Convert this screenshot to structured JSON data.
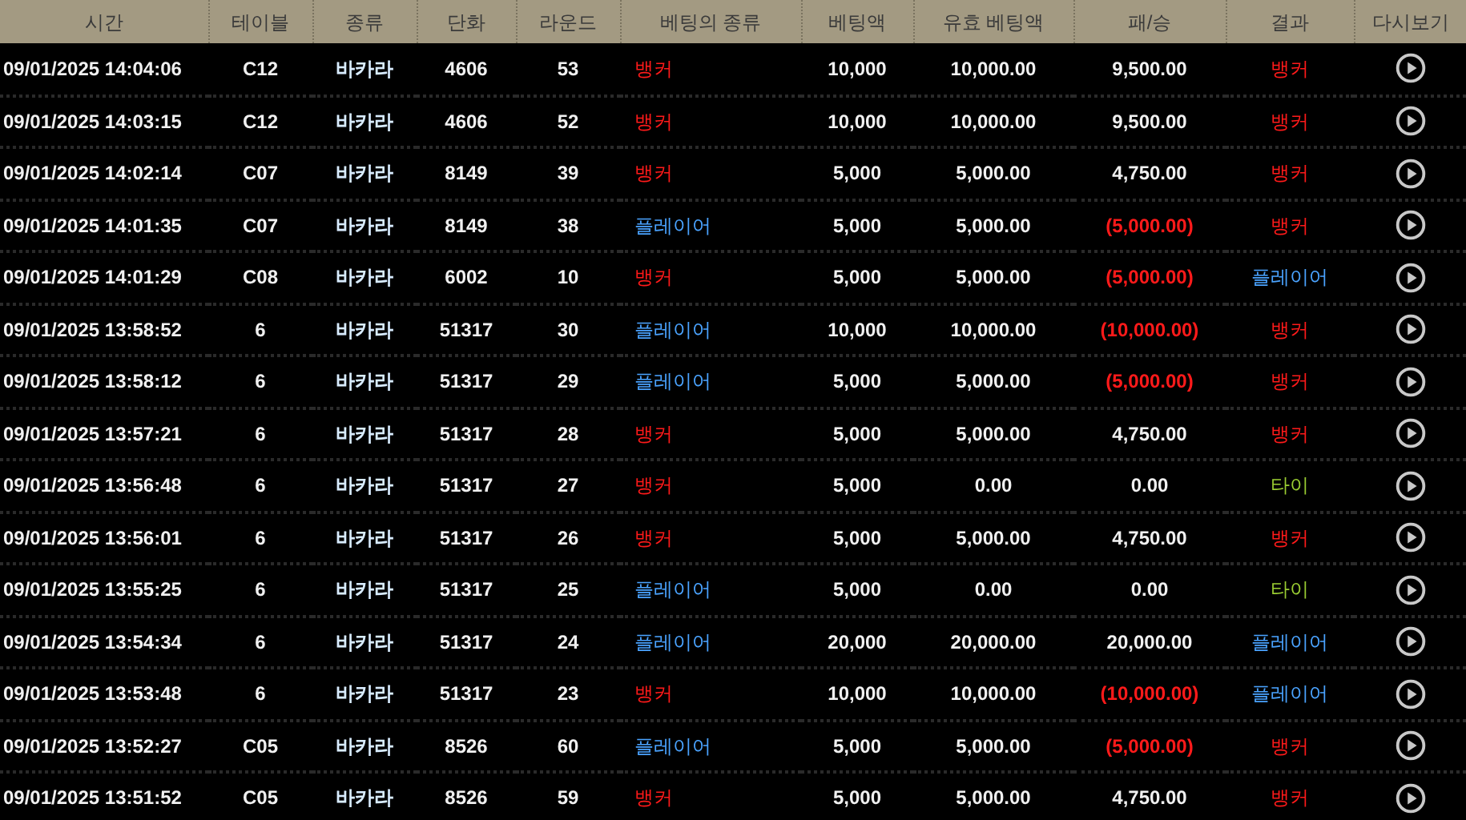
{
  "columns": [
    "시간",
    "테이블",
    "종류",
    "단화",
    "라운드",
    "베팅의 종류",
    "베팅액",
    "유효 베팅액",
    "패/승",
    "결과",
    "다시보기"
  ],
  "rows": [
    {
      "time": "09/01/2025 14:04:06",
      "table": "C12",
      "game": "바카라",
      "shoe": "4606",
      "round": "53",
      "bet": {
        "text": "뱅커",
        "kind": "banker"
      },
      "amount": "10,000",
      "valid": "10,000.00",
      "winloss": {
        "text": "9,500.00",
        "negative": false
      },
      "result": {
        "text": "뱅커",
        "kind": "banker"
      }
    },
    {
      "time": "09/01/2025 14:03:15",
      "table": "C12",
      "game": "바카라",
      "shoe": "4606",
      "round": "52",
      "bet": {
        "text": "뱅커",
        "kind": "banker"
      },
      "amount": "10,000",
      "valid": "10,000.00",
      "winloss": {
        "text": "9,500.00",
        "negative": false
      },
      "result": {
        "text": "뱅커",
        "kind": "banker"
      }
    },
    {
      "time": "09/01/2025 14:02:14",
      "table": "C07",
      "game": "바카라",
      "shoe": "8149",
      "round": "39",
      "bet": {
        "text": "뱅커",
        "kind": "banker"
      },
      "amount": "5,000",
      "valid": "5,000.00",
      "winloss": {
        "text": "4,750.00",
        "negative": false
      },
      "result": {
        "text": "뱅커",
        "kind": "banker"
      }
    },
    {
      "time": "09/01/2025 14:01:35",
      "table": "C07",
      "game": "바카라",
      "shoe": "8149",
      "round": "38",
      "bet": {
        "text": "플레이어",
        "kind": "player"
      },
      "amount": "5,000",
      "valid": "5,000.00",
      "winloss": {
        "text": "(5,000.00)",
        "negative": true
      },
      "result": {
        "text": "뱅커",
        "kind": "banker"
      }
    },
    {
      "time": "09/01/2025 14:01:29",
      "table": "C08",
      "game": "바카라",
      "shoe": "6002",
      "round": "10",
      "bet": {
        "text": "뱅커",
        "kind": "banker"
      },
      "amount": "5,000",
      "valid": "5,000.00",
      "winloss": {
        "text": "(5,000.00)",
        "negative": true
      },
      "result": {
        "text": "플레이어",
        "kind": "player"
      }
    },
    {
      "time": "09/01/2025 13:58:52",
      "table": "6",
      "game": "바카라",
      "shoe": "51317",
      "round": "30",
      "bet": {
        "text": "플레이어",
        "kind": "player"
      },
      "amount": "10,000",
      "valid": "10,000.00",
      "winloss": {
        "text": "(10,000.00)",
        "negative": true
      },
      "result": {
        "text": "뱅커",
        "kind": "banker"
      }
    },
    {
      "time": "09/01/2025 13:58:12",
      "table": "6",
      "game": "바카라",
      "shoe": "51317",
      "round": "29",
      "bet": {
        "text": "플레이어",
        "kind": "player"
      },
      "amount": "5,000",
      "valid": "5,000.00",
      "winloss": {
        "text": "(5,000.00)",
        "negative": true
      },
      "result": {
        "text": "뱅커",
        "kind": "banker"
      }
    },
    {
      "time": "09/01/2025 13:57:21",
      "table": "6",
      "game": "바카라",
      "shoe": "51317",
      "round": "28",
      "bet": {
        "text": "뱅커",
        "kind": "banker"
      },
      "amount": "5,000",
      "valid": "5,000.00",
      "winloss": {
        "text": "4,750.00",
        "negative": false
      },
      "result": {
        "text": "뱅커",
        "kind": "banker"
      }
    },
    {
      "time": "09/01/2025 13:56:48",
      "table": "6",
      "game": "바카라",
      "shoe": "51317",
      "round": "27",
      "bet": {
        "text": "뱅커",
        "kind": "banker"
      },
      "amount": "5,000",
      "valid": "0.00",
      "winloss": {
        "text": "0.00",
        "negative": false
      },
      "result": {
        "text": "타이",
        "kind": "tie"
      }
    },
    {
      "time": "09/01/2025 13:56:01",
      "table": "6",
      "game": "바카라",
      "shoe": "51317",
      "round": "26",
      "bet": {
        "text": "뱅커",
        "kind": "banker"
      },
      "amount": "5,000",
      "valid": "5,000.00",
      "winloss": {
        "text": "4,750.00",
        "negative": false
      },
      "result": {
        "text": "뱅커",
        "kind": "banker"
      }
    },
    {
      "time": "09/01/2025 13:55:25",
      "table": "6",
      "game": "바카라",
      "shoe": "51317",
      "round": "25",
      "bet": {
        "text": "플레이어",
        "kind": "player"
      },
      "amount": "5,000",
      "valid": "0.00",
      "winloss": {
        "text": "0.00",
        "negative": false
      },
      "result": {
        "text": "타이",
        "kind": "tie"
      }
    },
    {
      "time": "09/01/2025 13:54:34",
      "table": "6",
      "game": "바카라",
      "shoe": "51317",
      "round": "24",
      "bet": {
        "text": "플레이어",
        "kind": "player"
      },
      "amount": "20,000",
      "valid": "20,000.00",
      "winloss": {
        "text": "20,000.00",
        "negative": false
      },
      "result": {
        "text": "플레이어",
        "kind": "player"
      }
    },
    {
      "time": "09/01/2025 13:53:48",
      "table": "6",
      "game": "바카라",
      "shoe": "51317",
      "round": "23",
      "bet": {
        "text": "뱅커",
        "kind": "banker"
      },
      "amount": "10,000",
      "valid": "10,000.00",
      "winloss": {
        "text": "(10,000.00)",
        "negative": true
      },
      "result": {
        "text": "플레이어",
        "kind": "player"
      }
    },
    {
      "time": "09/01/2025 13:52:27",
      "table": "C05",
      "game": "바카라",
      "shoe": "8526",
      "round": "60",
      "bet": {
        "text": "플레이어",
        "kind": "player"
      },
      "amount": "5,000",
      "valid": "5,000.00",
      "winloss": {
        "text": "(5,000.00)",
        "negative": true
      },
      "result": {
        "text": "뱅커",
        "kind": "banker"
      }
    },
    {
      "time": "09/01/2025 13:51:52",
      "table": "C05",
      "game": "바카라",
      "shoe": "8526",
      "round": "59",
      "bet": {
        "text": "뱅커",
        "kind": "banker"
      },
      "amount": "5,000",
      "valid": "5,000.00",
      "winloss": {
        "text": "4,750.00",
        "negative": false
      },
      "result": {
        "text": "뱅커",
        "kind": "banker"
      }
    }
  ]
}
